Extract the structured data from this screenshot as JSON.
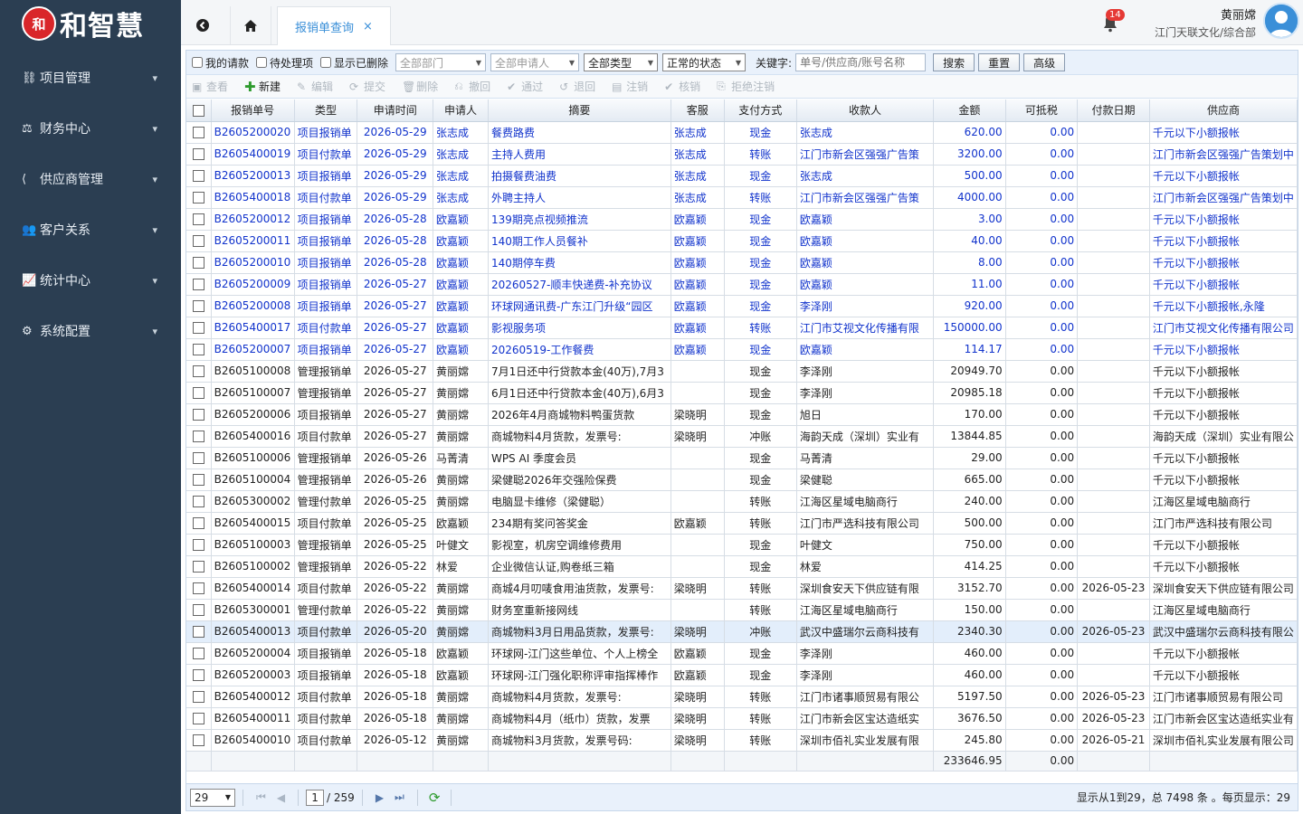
{
  "app": {
    "logo_mark": "和",
    "logo_text": "和智慧",
    "user_name": "黄丽嫦",
    "user_org": "江门天联文化/综合部",
    "notification_count": "14"
  },
  "sidebar": {
    "items": [
      {
        "label": "项目管理",
        "icon": "project-icon"
      },
      {
        "label": "财务中心",
        "icon": "finance-icon"
      },
      {
        "label": "供应商管理",
        "icon": "supplier-icon"
      },
      {
        "label": "客户关系",
        "icon": "customer-icon"
      },
      {
        "label": "统计中心",
        "icon": "chart-icon"
      },
      {
        "label": "系统配置",
        "icon": "gear-icon"
      }
    ]
  },
  "tabs": [
    {
      "label": "报销单查询",
      "close": "×"
    }
  ],
  "filters": {
    "my_requests": "我的请款",
    "pending": "待处理项",
    "show_deleted": "显示已删除",
    "dept": "全部部门",
    "applicant": "全部申请人",
    "type": "全部类型",
    "status": "正常的状态",
    "keyword_label": "关键字:",
    "keyword_placeholder": "单号/供应商/账号名称",
    "search": "搜索",
    "reset": "重置",
    "advanced": "高级"
  },
  "toolbar": {
    "view": "查看",
    "new": "新建",
    "edit": "编辑",
    "submit": "提交",
    "delete": "删除",
    "withdraw": "撤回",
    "approve": "通过",
    "reject": "退回",
    "cancel": "注销",
    "verify": "核销",
    "reject_cancel": "拒绝注销"
  },
  "columns": [
    "报销单号",
    "类型",
    "申请时间",
    "申请人",
    "摘要",
    "客服",
    "支付方式",
    "收款人",
    "金额",
    "可抵税",
    "付款日期",
    "供应商"
  ],
  "rows": [
    {
      "id": "B2605200020",
      "type": "项目报销单",
      "date": "2026-05-29",
      "applicant": "张志成",
      "summary": "餐费路费",
      "cs": "张志成",
      "pay": "现金",
      "payee": "张志成",
      "amount": "620.00",
      "tax": "0.00",
      "paydate": "",
      "supplier": "千元以下小额报帐",
      "project": true
    },
    {
      "id": "B2605400019",
      "type": "项目付款单",
      "date": "2026-05-29",
      "applicant": "张志成",
      "summary": "主持人费用",
      "cs": "张志成",
      "pay": "转账",
      "payee": "江门市新会区强强广告策",
      "amount": "3200.00",
      "tax": "0.00",
      "paydate": "",
      "supplier": "江门市新会区强强广告策划中",
      "project": true
    },
    {
      "id": "B2605200013",
      "type": "项目报销单",
      "date": "2026-05-29",
      "applicant": "张志成",
      "summary": "拍摄餐费油费",
      "cs": "张志成",
      "pay": "现金",
      "payee": "张志成",
      "amount": "500.00",
      "tax": "0.00",
      "paydate": "",
      "supplier": "千元以下小额报帐",
      "project": true
    },
    {
      "id": "B2605400018",
      "type": "项目付款单",
      "date": "2026-05-29",
      "applicant": "张志成",
      "summary": "外聘主持人",
      "cs": "张志成",
      "pay": "转账",
      "payee": "江门市新会区强强广告策",
      "amount": "4000.00",
      "tax": "0.00",
      "paydate": "",
      "supplier": "江门市新会区强强广告策划中",
      "project": true
    },
    {
      "id": "B2605200012",
      "type": "项目报销单",
      "date": "2026-05-28",
      "applicant": "欧嘉颖",
      "summary": "139期亮点视频推流",
      "cs": "欧嘉颖",
      "pay": "现金",
      "payee": "欧嘉颖",
      "amount": "3.00",
      "tax": "0.00",
      "paydate": "",
      "supplier": "千元以下小额报帐",
      "project": true
    },
    {
      "id": "B2605200011",
      "type": "项目报销单",
      "date": "2026-05-28",
      "applicant": "欧嘉颖",
      "summary": "140期工作人员餐补",
      "cs": "欧嘉颖",
      "pay": "现金",
      "payee": "欧嘉颖",
      "amount": "40.00",
      "tax": "0.00",
      "paydate": "",
      "supplier": "千元以下小额报帐",
      "project": true
    },
    {
      "id": "B2605200010",
      "type": "项目报销单",
      "date": "2026-05-28",
      "applicant": "欧嘉颖",
      "summary": "140期停车费",
      "cs": "欧嘉颖",
      "pay": "现金",
      "payee": "欧嘉颖",
      "amount": "8.00",
      "tax": "0.00",
      "paydate": "",
      "supplier": "千元以下小额报帐",
      "project": true
    },
    {
      "id": "B2605200009",
      "type": "项目报销单",
      "date": "2026-05-27",
      "applicant": "欧嘉颖",
      "summary": "20260527-顺丰快递费-补充协议",
      "cs": "欧嘉颖",
      "pay": "现金",
      "payee": "欧嘉颖",
      "amount": "11.00",
      "tax": "0.00",
      "paydate": "",
      "supplier": "千元以下小额报帐",
      "project": true
    },
    {
      "id": "B2605200008",
      "type": "项目报销单",
      "date": "2026-05-27",
      "applicant": "欧嘉颖",
      "summary": "环球网通讯费-广东江门升级“园区",
      "cs": "欧嘉颖",
      "pay": "现金",
      "payee": "李泽刚",
      "amount": "920.00",
      "tax": "0.00",
      "paydate": "",
      "supplier": "千元以下小额报帐,永隆",
      "project": true
    },
    {
      "id": "B2605400017",
      "type": "项目付款单",
      "date": "2026-05-27",
      "applicant": "欧嘉颖",
      "summary": "影视服务项",
      "cs": "欧嘉颖",
      "pay": "转账",
      "payee": "江门市艾视文化传播有限",
      "amount": "150000.00",
      "tax": "0.00",
      "paydate": "",
      "supplier": "江门市艾视文化传播有限公司",
      "project": true
    },
    {
      "id": "B2605200007",
      "type": "项目报销单",
      "date": "2026-05-27",
      "applicant": "欧嘉颖",
      "summary": "20260519-工作餐费",
      "cs": "欧嘉颖",
      "pay": "现金",
      "payee": "欧嘉颖",
      "amount": "114.17",
      "tax": "0.00",
      "paydate": "",
      "supplier": "千元以下小额报帐",
      "project": true
    },
    {
      "id": "B2605100008",
      "type": "管理报销单",
      "date": "2026-05-27",
      "applicant": "黄丽嫦",
      "summary": "7月1日还中行贷款本金(40万),7月3",
      "cs": "",
      "pay": "现金",
      "payee": "李泽刚",
      "amount": "20949.70",
      "tax": "0.00",
      "paydate": "",
      "supplier": "千元以下小额报帐",
      "project": false
    },
    {
      "id": "B2605100007",
      "type": "管理报销单",
      "date": "2026-05-27",
      "applicant": "黄丽嫦",
      "summary": "6月1日还中行贷款本金(40万),6月3",
      "cs": "",
      "pay": "现金",
      "payee": "李泽刚",
      "amount": "20985.18",
      "tax": "0.00",
      "paydate": "",
      "supplier": "千元以下小额报帐",
      "project": false
    },
    {
      "id": "B2605200006",
      "type": "项目报销单",
      "date": "2026-05-27",
      "applicant": "黄丽嫦",
      "summary": "2026年4月商城物料鸭蛋货款",
      "cs": "梁晓明",
      "pay": "现金",
      "payee": "旭日",
      "amount": "170.00",
      "tax": "0.00",
      "paydate": "",
      "supplier": "千元以下小额报帐",
      "project": false
    },
    {
      "id": "B2605400016",
      "type": "项目付款单",
      "date": "2026-05-27",
      "applicant": "黄丽嫦",
      "summary": "商城物料4月货款，发票号:",
      "cs": "梁晓明",
      "pay": "冲账",
      "payee": "海韵天成（深圳）实业有",
      "amount": "13844.85",
      "tax": "0.00",
      "paydate": "",
      "supplier": "海韵天成（深圳）实业有限公",
      "project": false
    },
    {
      "id": "B2605100006",
      "type": "管理报销单",
      "date": "2026-05-26",
      "applicant": "马菁清",
      "summary": "WPS AI 季度会员",
      "cs": "",
      "pay": "现金",
      "payee": "马菁清",
      "amount": "29.00",
      "tax": "0.00",
      "paydate": "",
      "supplier": "千元以下小额报帐",
      "project": false
    },
    {
      "id": "B2605100004",
      "type": "管理报销单",
      "date": "2026-05-26",
      "applicant": "黄丽嫦",
      "summary": "梁健聪2026年交强险保费",
      "cs": "",
      "pay": "现金",
      "payee": "梁健聪",
      "amount": "665.00",
      "tax": "0.00",
      "paydate": "",
      "supplier": "千元以下小额报帐",
      "project": false
    },
    {
      "id": "B2605300002",
      "type": "管理付款单",
      "date": "2026-05-25",
      "applicant": "黄丽嫦",
      "summary": "电脑显卡维修（梁健聪）",
      "cs": "",
      "pay": "转账",
      "payee": "江海区星域电脑商行",
      "amount": "240.00",
      "tax": "0.00",
      "paydate": "",
      "supplier": "江海区星域电脑商行",
      "project": false
    },
    {
      "id": "B2605400015",
      "type": "项目付款单",
      "date": "2026-05-25",
      "applicant": "欧嘉颖",
      "summary": "234期有奖问答奖金",
      "cs": "欧嘉颖",
      "pay": "转账",
      "payee": "江门市严选科技有限公司",
      "amount": "500.00",
      "tax": "0.00",
      "paydate": "",
      "supplier": "江门市严选科技有限公司",
      "project": false
    },
    {
      "id": "B2605100003",
      "type": "管理报销单",
      "date": "2026-05-25",
      "applicant": "叶健文",
      "summary": "影视室，机房空调维修费用",
      "cs": "",
      "pay": "现金",
      "payee": "叶健文",
      "amount": "750.00",
      "tax": "0.00",
      "paydate": "",
      "supplier": "千元以下小额报帐",
      "project": false
    },
    {
      "id": "B2605100002",
      "type": "管理报销单",
      "date": "2026-05-22",
      "applicant": "林爱",
      "summary": "企业微信认证,购卷纸三箱",
      "cs": "",
      "pay": "现金",
      "payee": "林爱",
      "amount": "414.25",
      "tax": "0.00",
      "paydate": "",
      "supplier": "千元以下小额报帐",
      "project": false
    },
    {
      "id": "B2605400014",
      "type": "项目付款单",
      "date": "2026-05-22",
      "applicant": "黄丽嫦",
      "summary": "商城4月叨唛食用油货款，发票号:",
      "cs": "梁晓明",
      "pay": "转账",
      "payee": "深圳食安天下供应链有限",
      "amount": "3152.70",
      "tax": "0.00",
      "paydate": "2026-05-23",
      "supplier": "深圳食安天下供应链有限公司",
      "project": false
    },
    {
      "id": "B2605300001",
      "type": "管理付款单",
      "date": "2026-05-22",
      "applicant": "黄丽嫦",
      "summary": "财务室重新接网线",
      "cs": "",
      "pay": "转账",
      "payee": "江海区星域电脑商行",
      "amount": "150.00",
      "tax": "0.00",
      "paydate": "",
      "supplier": "江海区星域电脑商行",
      "project": false
    },
    {
      "id": "B2605400013",
      "type": "项目付款单",
      "date": "2026-05-20",
      "applicant": "黄丽嫦",
      "summary": "商城物料3月日用品货款，发票号:",
      "cs": "梁晓明",
      "pay": "冲账",
      "payee": "武汉中盛瑞尔云商科技有",
      "amount": "2340.30",
      "tax": "0.00",
      "paydate": "2026-05-23",
      "supplier": "武汉中盛瑞尔云商科技有限公",
      "project": false,
      "selected": true
    },
    {
      "id": "B2605200004",
      "type": "项目报销单",
      "date": "2026-05-18",
      "applicant": "欧嘉颖",
      "summary": "环球网-江门这些单位、个人上榜全",
      "cs": "欧嘉颖",
      "pay": "现金",
      "payee": "李泽刚",
      "amount": "460.00",
      "tax": "0.00",
      "paydate": "",
      "supplier": "千元以下小额报帐",
      "project": false
    },
    {
      "id": "B2605200003",
      "type": "项目报销单",
      "date": "2026-05-18",
      "applicant": "欧嘉颖",
      "summary": "环球网-江门强化职称评审指挥棒作",
      "cs": "欧嘉颖",
      "pay": "现金",
      "payee": "李泽刚",
      "amount": "460.00",
      "tax": "0.00",
      "paydate": "",
      "supplier": "千元以下小额报帐",
      "project": false
    },
    {
      "id": "B2605400012",
      "type": "项目付款单",
      "date": "2026-05-18",
      "applicant": "黄丽嫦",
      "summary": "商城物料4月货款，发票号:",
      "cs": "梁晓明",
      "pay": "转账",
      "payee": "江门市诸事顺贸易有限公",
      "amount": "5197.50",
      "tax": "0.00",
      "paydate": "2026-05-23",
      "supplier": "江门市诸事顺贸易有限公司",
      "project": false
    },
    {
      "id": "B2605400011",
      "type": "项目付款单",
      "date": "2026-05-18",
      "applicant": "黄丽嫦",
      "summary": "商城物料4月（纸巾）货款，发票",
      "cs": "梁晓明",
      "pay": "转账",
      "payee": "江门市新会区宝达造纸实",
      "amount": "3676.50",
      "tax": "0.00",
      "paydate": "2026-05-23",
      "supplier": "江门市新会区宝达造纸实业有",
      "project": false
    },
    {
      "id": "B2605400010",
      "type": "项目付款单",
      "date": "2026-05-12",
      "applicant": "黄丽嫦",
      "summary": "商城物料3月货款，发票号码:",
      "cs": "梁晓明",
      "pay": "转账",
      "payee": "深圳市佰礼实业发展有限",
      "amount": "245.80",
      "tax": "0.00",
      "paydate": "2026-05-21",
      "supplier": "深圳市佰礼实业发展有限公司",
      "project": false
    }
  ],
  "totals": {
    "amount": "233646.95",
    "tax": "0.00"
  },
  "pager": {
    "page_size": "29",
    "page": "1",
    "total_pages": "/ 259",
    "info": "显示从1到29，总 7498 条 。每页显示：29"
  }
}
